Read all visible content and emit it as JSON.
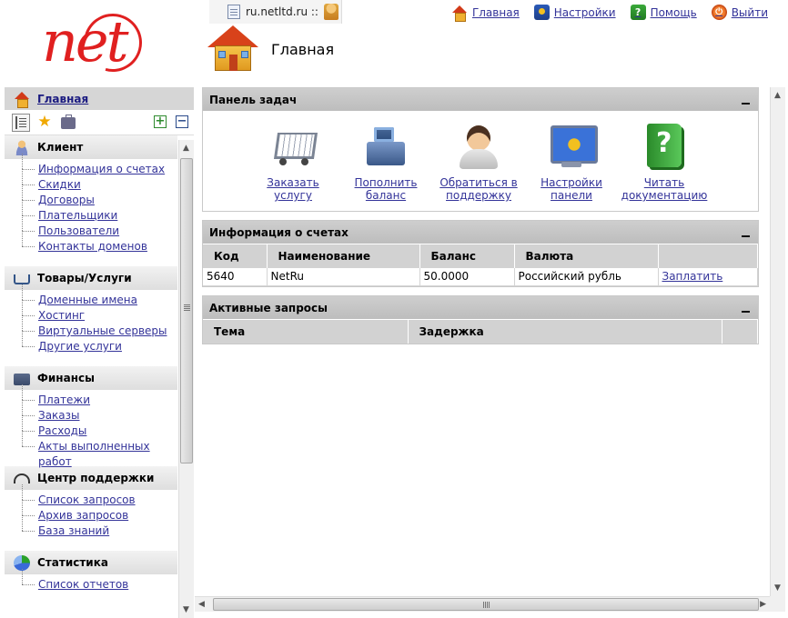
{
  "logo": {
    "text": "net"
  },
  "site_tab": {
    "label": "ru.netltd.ru ::"
  },
  "top_menu": {
    "home": "Главная",
    "settings": "Настройки",
    "help": "Помощь",
    "exit": "Выйти"
  },
  "page": {
    "title": "Главная"
  },
  "sidebar": {
    "home": "Главная",
    "sections": [
      {
        "title": "Клиент",
        "items": [
          "Информация о счетах",
          "Скидки",
          "Договоры",
          "Плательщики",
          "Пользователи",
          "Контакты доменов"
        ]
      },
      {
        "title": "Товары/Услуги",
        "items": [
          "Доменные имена",
          "Хостинг",
          "Виртуальные серверы",
          "Другие услуги"
        ]
      },
      {
        "title": "Финансы",
        "items": [
          "Платежи",
          "Заказы",
          "Расходы",
          "Акты выполненных работ"
        ]
      },
      {
        "title": "Центр поддержки",
        "items": [
          "Список запросов",
          "Архив запросов",
          "База знаний"
        ]
      },
      {
        "title": "Статистика",
        "items": [
          "Список отчетов"
        ]
      }
    ]
  },
  "tasks_panel": {
    "title": "Панель задач",
    "items": [
      {
        "line1": "Заказать услугу",
        "line2": ""
      },
      {
        "line1": "Пополнить",
        "line2": "баланс"
      },
      {
        "line1": "Обратиться в",
        "line2": "поддержку"
      },
      {
        "line1": "Настройки",
        "line2": "панели"
      },
      {
        "line1": "Читать",
        "line2": "документацию"
      }
    ]
  },
  "accounts_panel": {
    "title": "Информация о счетах",
    "columns": [
      "Код",
      "Наименование",
      "Баланс",
      "Валюта",
      ""
    ],
    "rows": [
      {
        "code": "5640",
        "name": "NetRu",
        "balance": "50.0000",
        "currency": "Российский рубль",
        "action": "Заплатить"
      }
    ]
  },
  "requests_panel": {
    "title": "Активные запросы",
    "columns": [
      "Тема",
      "Задержка",
      ""
    ]
  }
}
